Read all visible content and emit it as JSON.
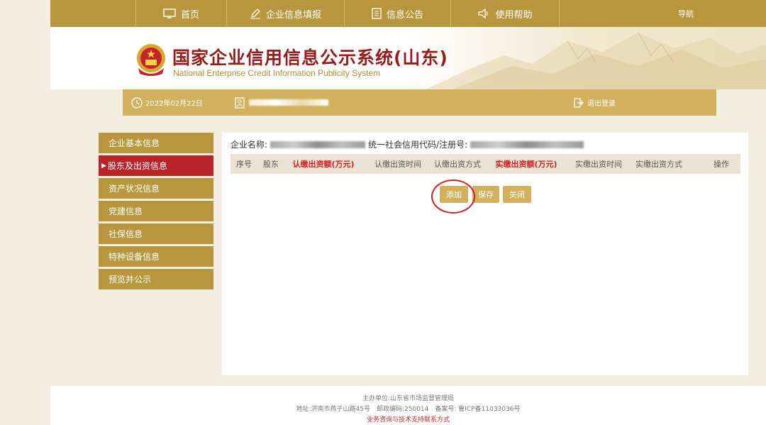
{
  "nav": {
    "items": [
      {
        "label": "首页",
        "icon": "monitor-icon"
      },
      {
        "label": "企业信息填报",
        "icon": "pen-icon"
      },
      {
        "label": "信息公告",
        "icon": "document-icon"
      },
      {
        "label": "使用帮助",
        "icon": "speaker-icon"
      }
    ],
    "guide_label": "导航"
  },
  "header": {
    "title": "国家企业信用信息公示系统(山东)",
    "subtitle": "National Enterprise Credit Information Publicity System"
  },
  "infobar": {
    "date": "2022年02月22日",
    "logout_label": "退出登录"
  },
  "sidebar": {
    "items": [
      {
        "label": "企业基本信息"
      },
      {
        "label": "股东及出资信息",
        "active": true
      },
      {
        "label": "资产状况信息"
      },
      {
        "label": "党建信息"
      },
      {
        "label": "社保信息"
      },
      {
        "label": "特种设备信息"
      },
      {
        "label": "预览并公示"
      }
    ]
  },
  "main": {
    "company_name_label": "企业名称:",
    "credit_code_label": "统一社会信用代码/注册号:",
    "table_headers": [
      "序号",
      "股东",
      "认缴出资额(万元)",
      "认缴出资时间",
      "认缴出资方式",
      "实缴出资额(万元)",
      "实缴出资时间",
      "实缴出资方式",
      "操作"
    ],
    "buttons": {
      "add": "添加",
      "save": "保存",
      "close": "关闭"
    }
  },
  "footer": {
    "line1": "主办单位:山东省市场监督管理局",
    "line2": "地址:济南市燕子山路45号　邮政编码:250014　备案号: 鲁ICP备11033036号",
    "line3": "业务咨询与技术支持联系方式"
  },
  "colors": {
    "gold": "#b8963e",
    "light_gold": "#d2b15e",
    "active_red": "#b7252a",
    "header_red": "#d21c1c"
  }
}
